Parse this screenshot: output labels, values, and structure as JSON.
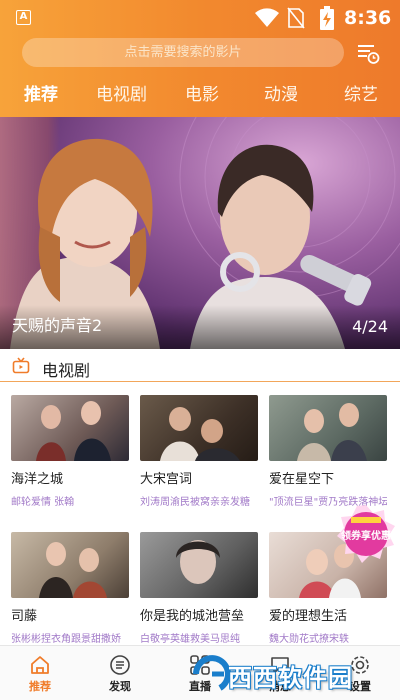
{
  "status_bar": {
    "time": "8:36",
    "app_icon_letter": "A"
  },
  "search": {
    "placeholder": "点击需要搜索的影片"
  },
  "tabs": [
    {
      "label": "推荐",
      "active": true
    },
    {
      "label": "电视剧",
      "active": false
    },
    {
      "label": "电影",
      "active": false
    },
    {
      "label": "动漫",
      "active": false
    },
    {
      "label": "综艺",
      "active": false
    }
  ],
  "banner": {
    "title": "天赐的声音2",
    "counter": "4/24"
  },
  "section": {
    "title": "电视剧"
  },
  "cards": [
    {
      "name": "海洋之城",
      "desc": "邮轮爱情      张翰"
    },
    {
      "name": "大宋宫词",
      "desc": "刘涛周渝民被窝亲亲发糖"
    },
    {
      "name": "爱在星空下",
      "desc": "\"顶流巨星\"贾乃亮跌落神坛"
    },
    {
      "name": "司藤",
      "desc": "张彬彬捏衣角跟景甜撒娇"
    },
    {
      "name": "你是我的城池营垒",
      "desc": "白敬亭英雄救美马思纯"
    },
    {
      "name": "爱的理想生活",
      "desc": "魏大勋花式撩宋轶"
    }
  ],
  "coupon": {
    "text": "领券享优惠"
  },
  "bottom_nav": [
    {
      "label": "推荐",
      "icon": "home-icon",
      "active": true
    },
    {
      "label": "发现",
      "icon": "discover-icon",
      "active": false
    },
    {
      "label": "直播",
      "icon": "live-icon",
      "active": false
    },
    {
      "label": "消息",
      "icon": "message-icon",
      "active": false
    },
    {
      "label": "设置",
      "icon": "settings-icon",
      "active": false
    }
  ],
  "watermark": {
    "text": "西西软件园"
  },
  "colors": {
    "accent": "#f07c2a",
    "header_gradient_start": "#f7a33a",
    "desc_purple": "#a27ac8"
  }
}
